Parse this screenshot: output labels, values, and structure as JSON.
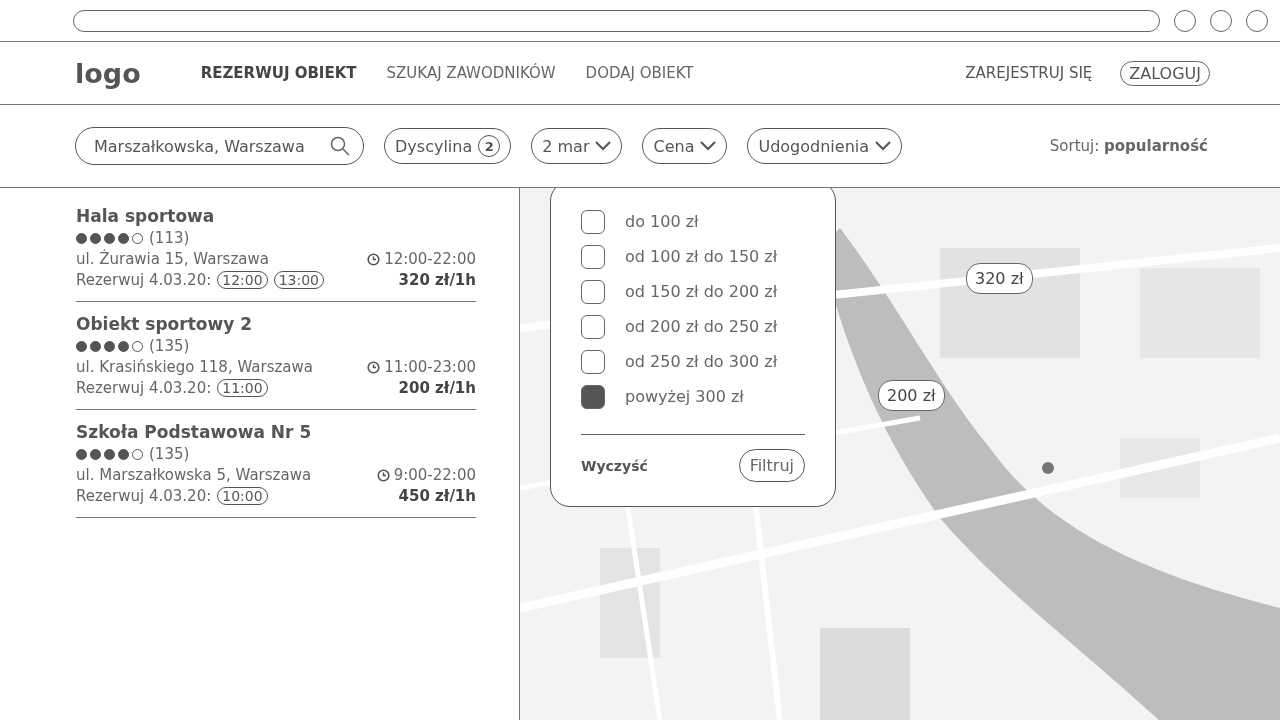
{
  "nav": {
    "logo": "logo",
    "items": [
      {
        "label": "REZERWUJ OBIEKT",
        "selected": true
      },
      {
        "label": "SZUKAJ ZAWODNIKÓW",
        "selected": false
      },
      {
        "label": "DODAJ OBIEKT",
        "selected": false
      }
    ],
    "register": "ZAREJESTRUJ SIĘ",
    "login": "ZALOGUJ"
  },
  "filters": {
    "search": {
      "value": "Marszałkowska, Warszawa"
    },
    "chips": [
      {
        "kind": "count",
        "label": "Dyscylina",
        "count": "2"
      },
      {
        "kind": "dropdown",
        "label": "2 mar"
      },
      {
        "kind": "dropdown",
        "label": "Cena"
      },
      {
        "kind": "dropdown",
        "label": "Udogodnienia"
      }
    ],
    "sort": "Sortuj: **popularność**"
  },
  "venues": [
    {
      "name": "Hala sportowa",
      "stars": 4,
      "reviews": "(113)",
      "address": "ul. Żurawia 15, Warszawa",
      "hours": "12:00-22:00",
      "book": "Rezerwuj 4.03.20:",
      "slots": [
        "12:00",
        "13:00"
      ],
      "price": "320 zł/1h"
    },
    {
      "name": "Obiekt sportowy 2",
      "stars": 4,
      "reviews": "(135)",
      "address": "ul. Krasińskiego 118, Warszawa",
      "hours": "11:00-23:00",
      "book": "Rezerwuj 4.03.20:",
      "slots": [
        "11:00"
      ],
      "price": "200 zł/1h"
    },
    {
      "name": "Szkoła Podstawowa Nr 5",
      "stars": 4,
      "reviews": "(135)",
      "address": "ul. Marszałkowska 5, Warszawa",
      "hours": "9:00-22:00",
      "book": "Rezerwuj 4.03.20:",
      "slots": [
        "10:00"
      ],
      "price": "450 zł/1h"
    }
  ],
  "map": {
    "kind": "picture",
    "pins": [
      "320 zł",
      "200 zł"
    ]
  },
  "price_dropdown": {
    "options": [
      {
        "label": "do 100 zł",
        "checked": false
      },
      {
        "label": "od 100 zł do 150 zł",
        "checked": false
      },
      {
        "label": "od 150 zł do 200 zł",
        "checked": false
      },
      {
        "label": "od 200 zł do 250 zł",
        "checked": false
      },
      {
        "label": "od 250 zł do 300 zł",
        "checked": false
      },
      {
        "label": "powyżej 300 zł",
        "checked": true
      }
    ],
    "clear": "Wyczyść",
    "apply": "Filtruj"
  }
}
